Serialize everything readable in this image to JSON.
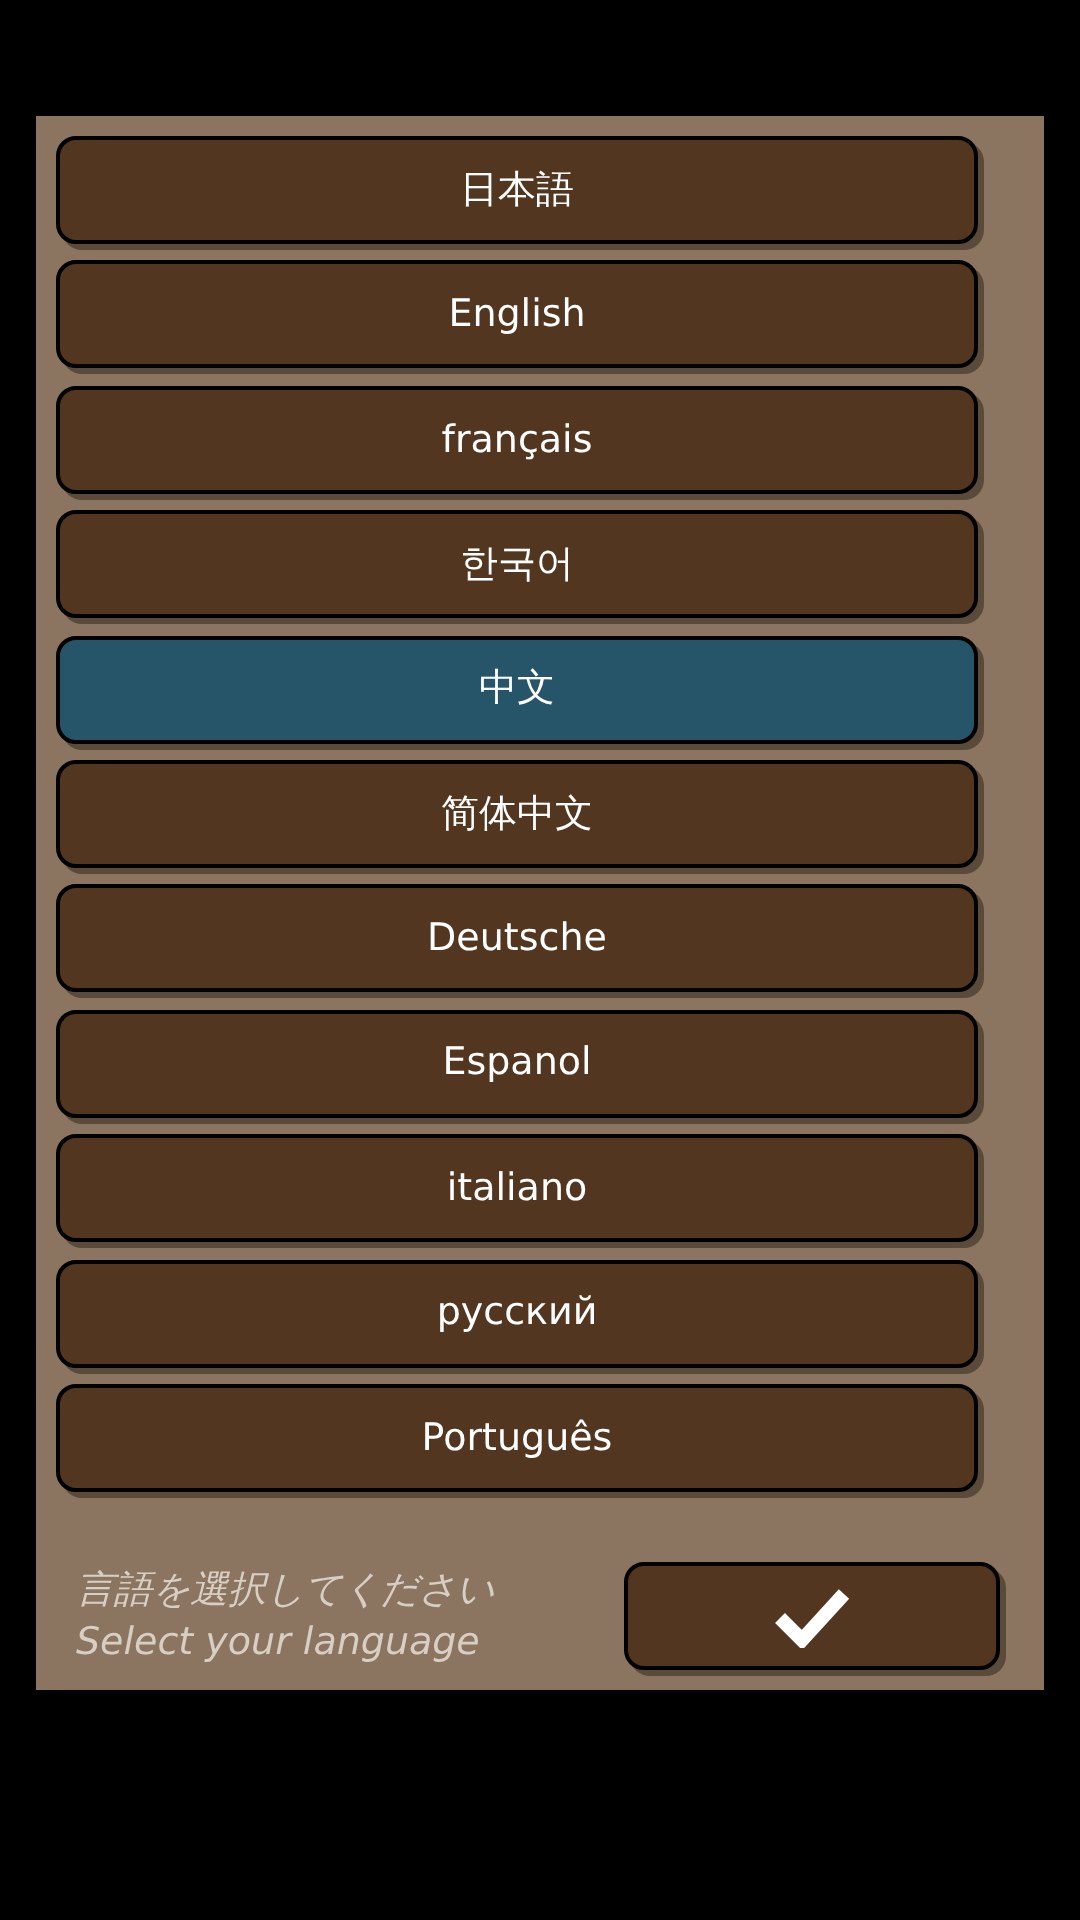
{
  "languages": [
    {
      "label": "日本語",
      "selected": false
    },
    {
      "label": "English",
      "selected": false
    },
    {
      "label": "français",
      "selected": false
    },
    {
      "label": "한국어",
      "selected": false
    },
    {
      "label": "中文",
      "selected": true
    },
    {
      "label": "简体中文",
      "selected": false
    },
    {
      "label": "Deutsche",
      "selected": false
    },
    {
      "label": "Espanol",
      "selected": false
    },
    {
      "label": "italiano",
      "selected": false
    },
    {
      "label": "русский",
      "selected": false
    },
    {
      "label": "Português",
      "selected": false
    }
  ],
  "prompt": [
    "言語を選択してください",
    "Select your language"
  ]
}
